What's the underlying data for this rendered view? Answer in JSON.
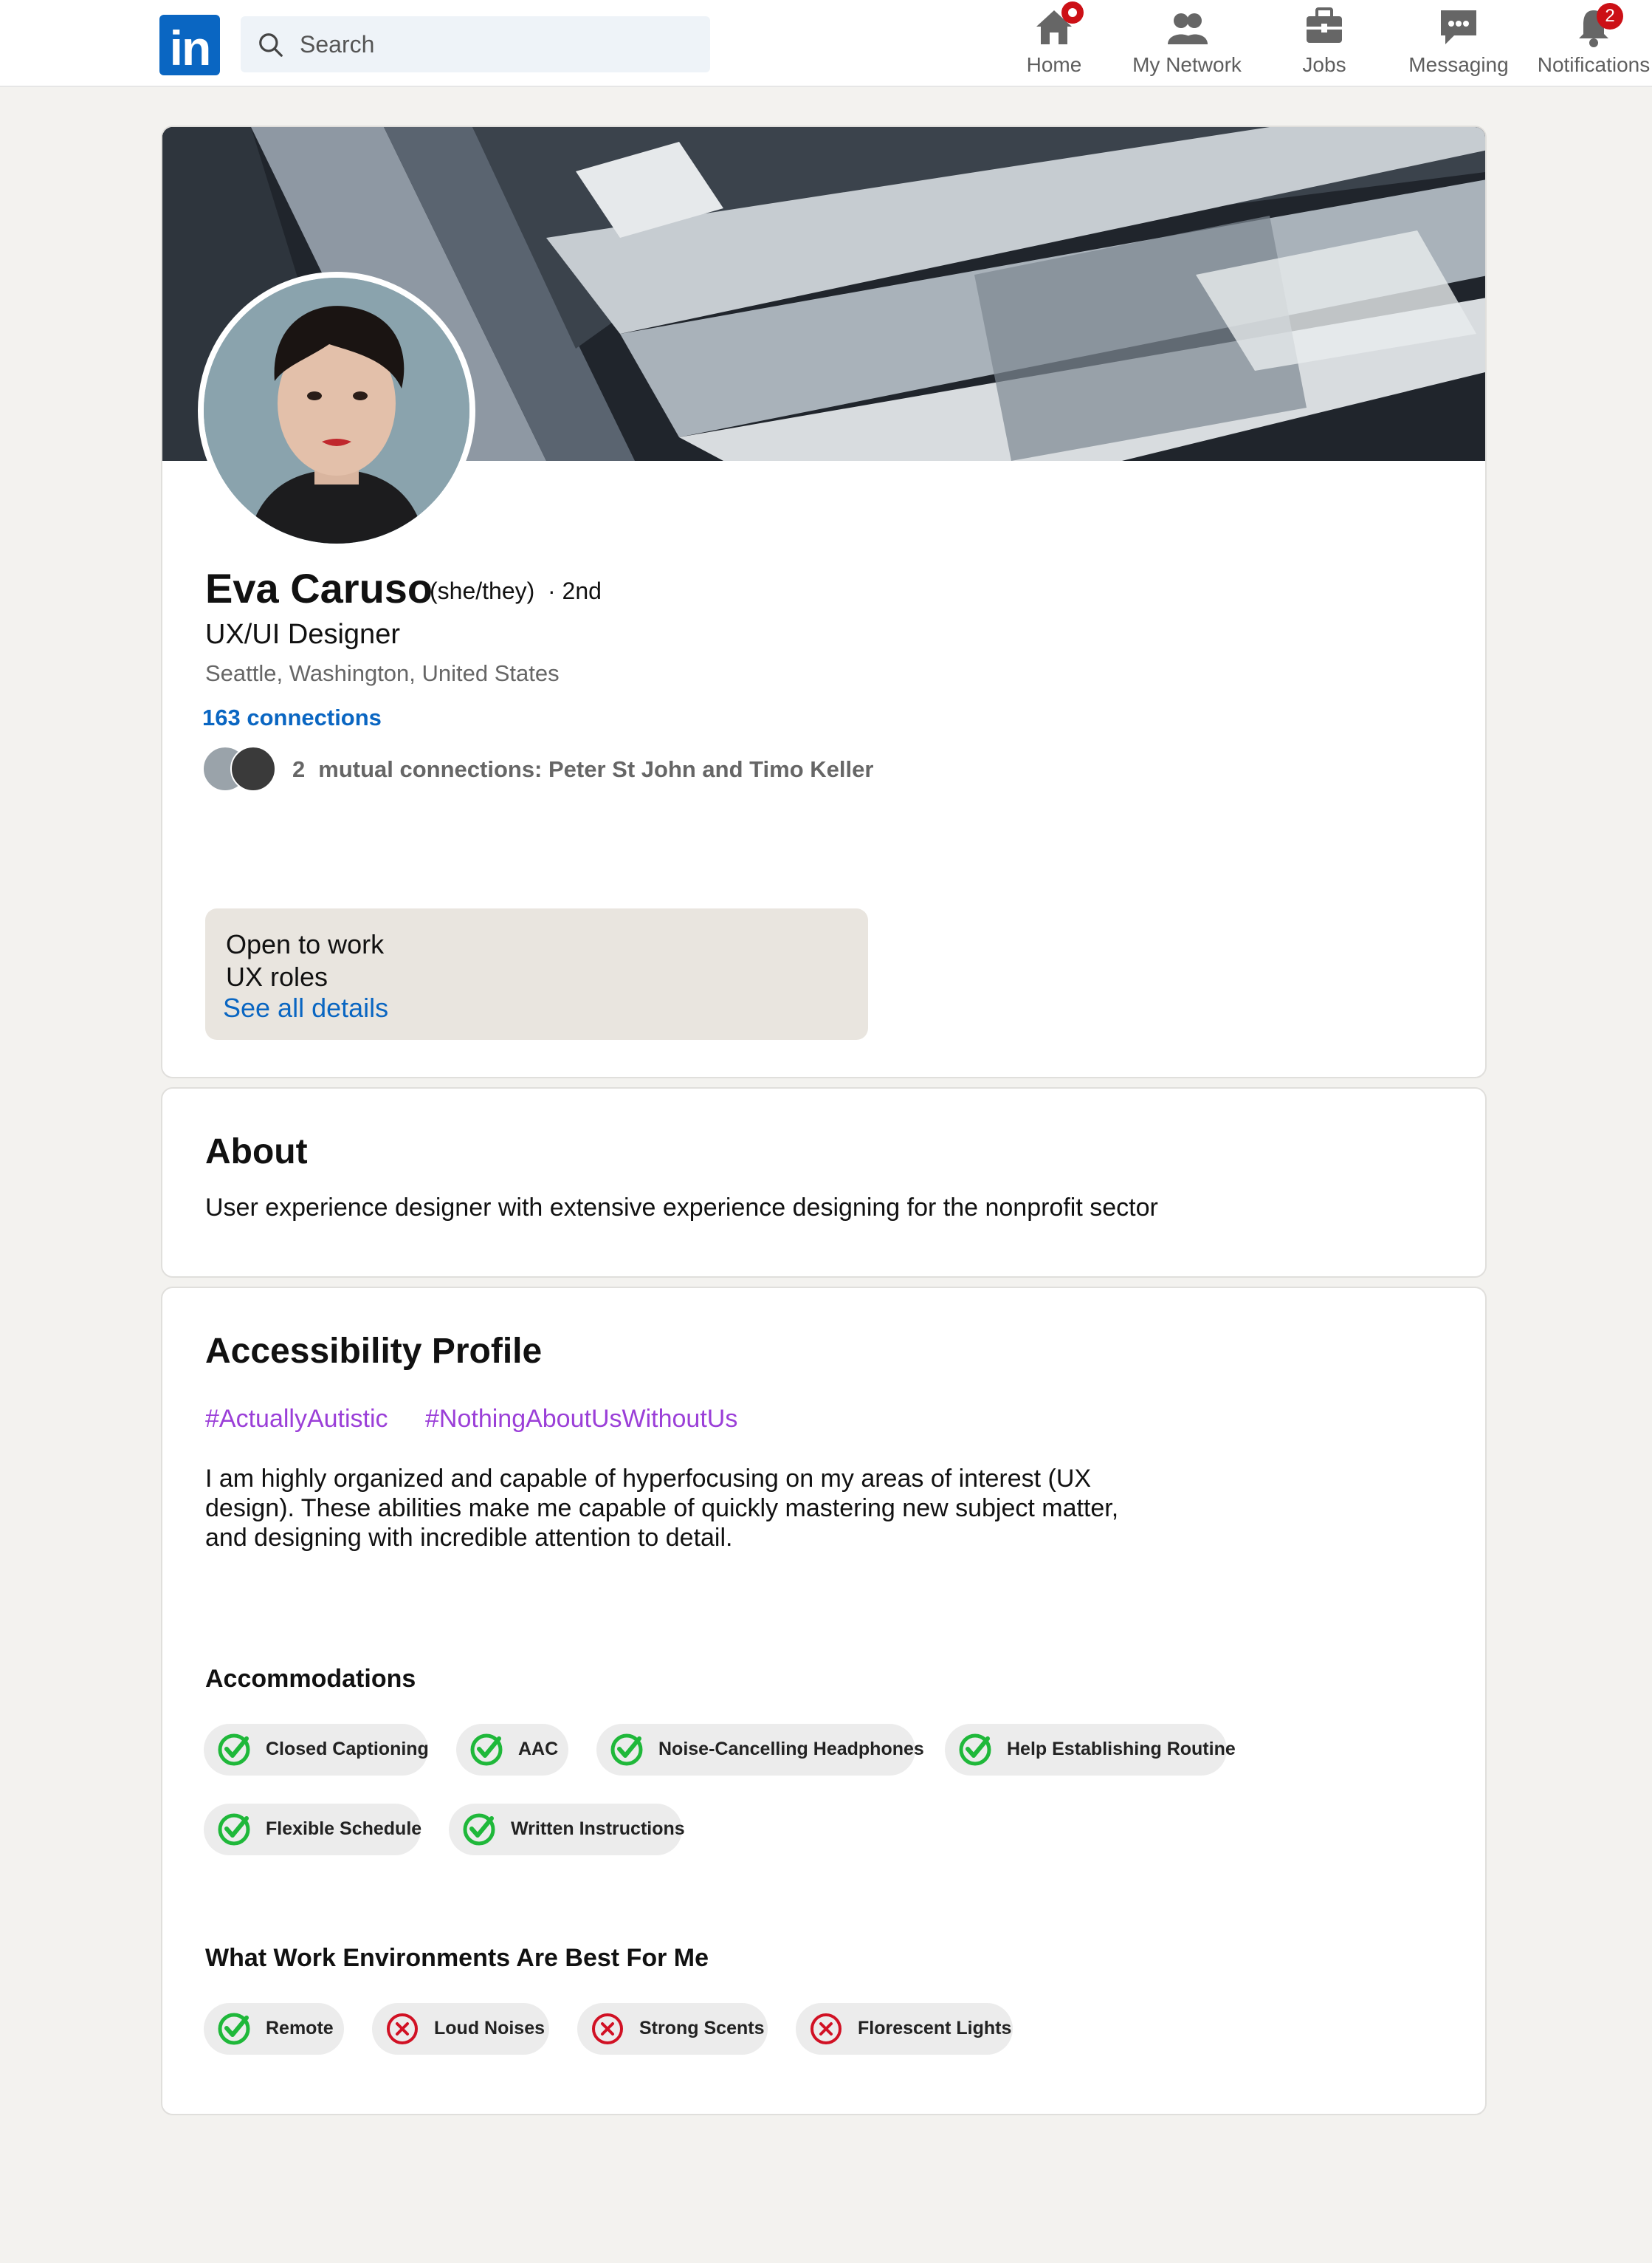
{
  "nav": {
    "logo_text": "in",
    "search_placeholder": "Search",
    "items": [
      {
        "label": "Home",
        "icon": "home-icon"
      },
      {
        "label": "My Network",
        "icon": "network-icon"
      },
      {
        "label": "Jobs",
        "icon": "briefcase-icon"
      },
      {
        "label": "Messaging",
        "icon": "chat-icon"
      },
      {
        "label": "Notifications",
        "icon": "bell-icon",
        "badge": "2"
      }
    ]
  },
  "profile": {
    "name": "Eva Caruso",
    "pronouns": "(she/they)",
    "degree": "· 2nd",
    "headline": "UX/UI Designer",
    "location": "Seattle, Washington, United States",
    "connections": "163 connections",
    "mutual_count": "2",
    "mutual_text": "mutual connections: Peter St John and Timo Keller",
    "open_to_work": {
      "title": "Open to work",
      "roles": "UX roles",
      "link": "See all details"
    }
  },
  "about": {
    "heading": "About",
    "text": "User experience designer with extensive experience designing for the nonprofit sector"
  },
  "accessibility": {
    "heading": "Accessibility Profile",
    "tags": [
      "#ActuallyAutistic",
      "#NothingAboutUsWithoutUs"
    ],
    "text": "I am highly organized and capable of hyperfocusing on my areas of interest (UX design). These abilities make me capable of quickly mastering new subject matter, and designing with incredible attention to detail.",
    "accommodations_heading": "Accommodations",
    "accommodations": [
      {
        "label": "Closed Captioning",
        "status": "yes"
      },
      {
        "label": "AAC",
        "status": "yes"
      },
      {
        "label": "Noise-Cancelling Headphones",
        "status": "yes"
      },
      {
        "label": "Help Establishing Routine",
        "status": "yes"
      },
      {
        "label": "Flexible Schedule",
        "status": "yes"
      },
      {
        "label": "Written Instructions",
        "status": "yes"
      }
    ],
    "environments_heading": "What Work Environments Are Best For Me",
    "environments": [
      {
        "label": "Remote",
        "status": "yes"
      },
      {
        "label": "Loud Noises",
        "status": "no"
      },
      {
        "label": "Strong Scents",
        "status": "no"
      },
      {
        "label": "Florescent Lights",
        "status": "no"
      }
    ]
  },
  "colors": {
    "brand": "#0a66c2",
    "check": "#1fb83a",
    "cross": "#d11124",
    "hashtag": "#9b3fd8"
  }
}
